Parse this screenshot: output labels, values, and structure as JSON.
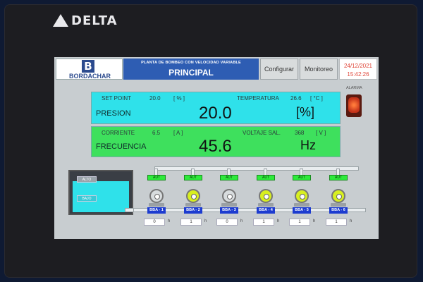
{
  "device": {
    "brand": "DELTA"
  },
  "header": {
    "company": "BORDACHAR",
    "subtitle": "PLANTA DE BOMBEO CON VELOCIDAD VARIABLE",
    "title": "PRINCIPAL",
    "nav": [
      "Configurar",
      "Monitoreo"
    ],
    "date": "24/12/2021",
    "time": "15:42:26"
  },
  "panel1": {
    "setpoint_label": "SET POINT",
    "setpoint_value": "20.0",
    "setpoint_unit": "[ % ]",
    "temp_label": "TEMPERATURA",
    "temp_value": "26.6",
    "temp_unit": "[ °C ]",
    "main_label": "PRESION",
    "main_value": "20.0",
    "main_unit": "[%]"
  },
  "panel2": {
    "current_label": "CORRIENTE",
    "current_value": "6.5",
    "current_unit": "[ A ]",
    "voltage_label": "VOLTAJE SAL.",
    "voltage_value": "368",
    "voltage_unit": "[ V ]",
    "main_label": "FRECUENCIA",
    "main_value": "45.6",
    "main_unit": "Hz"
  },
  "alarm": {
    "label": "ALARMA",
    "color": "#e0472a"
  },
  "tank": {
    "high_label": "ALTO",
    "low_label": "BAJO"
  },
  "pumps": [
    {
      "mode": "AUT",
      "name": "BBA - 1",
      "hours": "0",
      "hours_unit": "h",
      "state": "off"
    },
    {
      "mode": "AUT",
      "name": "BBA - 2",
      "hours": "1",
      "hours_unit": "h",
      "state": "on"
    },
    {
      "mode": "AUT",
      "name": "BBA - 3",
      "hours": "0",
      "hours_unit": "h",
      "state": "off"
    },
    {
      "mode": "AUT",
      "name": "BBA - 4",
      "hours": "1",
      "hours_unit": "h",
      "state": "on"
    },
    {
      "mode": "AUT",
      "name": "BBA - 5",
      "hours": "1",
      "hours_unit": "h",
      "state": "on"
    },
    {
      "mode": "AUT",
      "name": "BBA - 6",
      "hours": "1",
      "hours_unit": "h",
      "state": "on"
    }
  ],
  "colors": {
    "panel1": "#2fe1ea",
    "panel2": "#3ee05d",
    "title_bar": "#2e5db3",
    "pump_on": "#d8ef20"
  }
}
